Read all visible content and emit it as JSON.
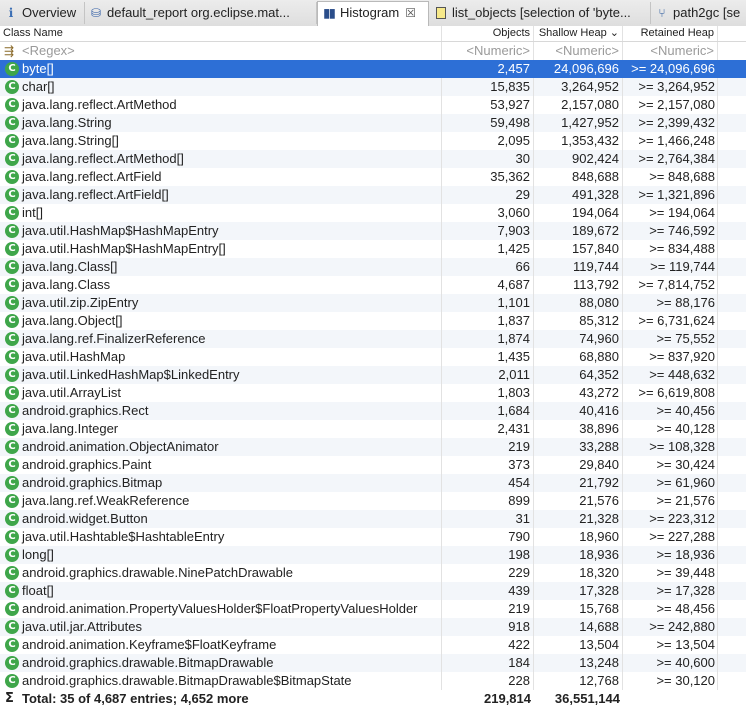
{
  "tabs": [
    {
      "icon": "info-icon",
      "label": "Overview",
      "active": false
    },
    {
      "icon": "report-icon",
      "label": "default_report  org.eclipse.mat...",
      "active": false
    },
    {
      "icon": "histogram-icon",
      "label": "Histogram",
      "active": true,
      "close": "☒"
    },
    {
      "icon": "list-icon",
      "label": "list_objects [selection of 'byte...",
      "active": false
    },
    {
      "icon": "tree-icon",
      "label": "path2gc [se",
      "active": false
    }
  ],
  "columns": {
    "class_name": "Class Name",
    "objects": "Objects",
    "shallow_heap": "Shallow Heap",
    "shallow_sort": "⌄",
    "retained_heap": "Retained Heap"
  },
  "filter": {
    "regex": "<Regex>",
    "objects": "<Numeric>",
    "shallow": "<Numeric>",
    "retained": "<Numeric>"
  },
  "rows": [
    {
      "name": "byte[]",
      "objects": "2,457",
      "shallow": "24,096,696",
      "retained": ">= 24,096,696"
    },
    {
      "name": "char[]",
      "objects": "15,835",
      "shallow": "3,264,952",
      "retained": ">= 3,264,952"
    },
    {
      "name": "java.lang.reflect.ArtMethod",
      "objects": "53,927",
      "shallow": "2,157,080",
      "retained": ">= 2,157,080"
    },
    {
      "name": "java.lang.String",
      "objects": "59,498",
      "shallow": "1,427,952",
      "retained": ">= 2,399,432"
    },
    {
      "name": "java.lang.String[]",
      "objects": "2,095",
      "shallow": "1,353,432",
      "retained": ">= 1,466,248"
    },
    {
      "name": "java.lang.reflect.ArtMethod[]",
      "objects": "30",
      "shallow": "902,424",
      "retained": ">= 2,764,384"
    },
    {
      "name": "java.lang.reflect.ArtField",
      "objects": "35,362",
      "shallow": "848,688",
      "retained": ">= 848,688"
    },
    {
      "name": "java.lang.reflect.ArtField[]",
      "objects": "29",
      "shallow": "491,328",
      "retained": ">= 1,321,896"
    },
    {
      "name": "int[]",
      "objects": "3,060",
      "shallow": "194,064",
      "retained": ">= 194,064"
    },
    {
      "name": "java.util.HashMap$HashMapEntry",
      "objects": "7,903",
      "shallow": "189,672",
      "retained": ">= 746,592"
    },
    {
      "name": "java.util.HashMap$HashMapEntry[]",
      "objects": "1,425",
      "shallow": "157,840",
      "retained": ">= 834,488"
    },
    {
      "name": "java.lang.Class[]",
      "objects": "66",
      "shallow": "119,744",
      "retained": ">= 119,744"
    },
    {
      "name": "java.lang.Class",
      "objects": "4,687",
      "shallow": "113,792",
      "retained": ">= 7,814,752"
    },
    {
      "name": "java.util.zip.ZipEntry",
      "objects": "1,101",
      "shallow": "88,080",
      "retained": ">= 88,176"
    },
    {
      "name": "java.lang.Object[]",
      "objects": "1,837",
      "shallow": "85,312",
      "retained": ">= 6,731,624"
    },
    {
      "name": "java.lang.ref.FinalizerReference",
      "objects": "1,874",
      "shallow": "74,960",
      "retained": ">= 75,552"
    },
    {
      "name": "java.util.HashMap",
      "objects": "1,435",
      "shallow": "68,880",
      "retained": ">= 837,920"
    },
    {
      "name": "java.util.LinkedHashMap$LinkedEntry",
      "objects": "2,011",
      "shallow": "64,352",
      "retained": ">= 448,632"
    },
    {
      "name": "java.util.ArrayList",
      "objects": "1,803",
      "shallow": "43,272",
      "retained": ">= 6,619,808"
    },
    {
      "name": "android.graphics.Rect",
      "objects": "1,684",
      "shallow": "40,416",
      "retained": ">= 40,456"
    },
    {
      "name": "java.lang.Integer",
      "objects": "2,431",
      "shallow": "38,896",
      "retained": ">= 40,128"
    },
    {
      "name": "android.animation.ObjectAnimator",
      "objects": "219",
      "shallow": "33,288",
      "retained": ">= 108,328"
    },
    {
      "name": "android.graphics.Paint",
      "objects": "373",
      "shallow": "29,840",
      "retained": ">= 30,424"
    },
    {
      "name": "android.graphics.Bitmap",
      "objects": "454",
      "shallow": "21,792",
      "retained": ">= 61,960"
    },
    {
      "name": "java.lang.ref.WeakReference",
      "objects": "899",
      "shallow": "21,576",
      "retained": ">= 21,576"
    },
    {
      "name": "android.widget.Button",
      "objects": "31",
      "shallow": "21,328",
      "retained": ">= 223,312"
    },
    {
      "name": "java.util.Hashtable$HashtableEntry",
      "objects": "790",
      "shallow": "18,960",
      "retained": ">= 227,288"
    },
    {
      "name": "long[]",
      "objects": "198",
      "shallow": "18,936",
      "retained": ">= 18,936"
    },
    {
      "name": "android.graphics.drawable.NinePatchDrawable",
      "objects": "229",
      "shallow": "18,320",
      "retained": ">= 39,448"
    },
    {
      "name": "float[]",
      "objects": "439",
      "shallow": "17,328",
      "retained": ">= 17,328"
    },
    {
      "name": "android.animation.PropertyValuesHolder$FloatPropertyValuesHolder",
      "objects": "219",
      "shallow": "15,768",
      "retained": ">= 48,456"
    },
    {
      "name": "java.util.jar.Attributes",
      "objects": "918",
      "shallow": "14,688",
      "retained": ">= 242,880"
    },
    {
      "name": "android.animation.Keyframe$FloatKeyframe",
      "objects": "422",
      "shallow": "13,504",
      "retained": ">= 13,504"
    },
    {
      "name": "android.graphics.drawable.BitmapDrawable",
      "objects": "184",
      "shallow": "13,248",
      "retained": ">= 40,600"
    },
    {
      "name": "android.graphics.drawable.BitmapDrawable$BitmapState",
      "objects": "228",
      "shallow": "12,768",
      "retained": ">= 30,120"
    }
  ],
  "class_icon_letter": "C",
  "total": {
    "sigma": "Σ",
    "label": "Total: 35 of 4,687 entries; 4,652 more",
    "objects": "219,814",
    "shallow": "36,551,144"
  },
  "colors": {
    "selection": "#2d6fd6",
    "class_icon": "#3fa64a"
  }
}
